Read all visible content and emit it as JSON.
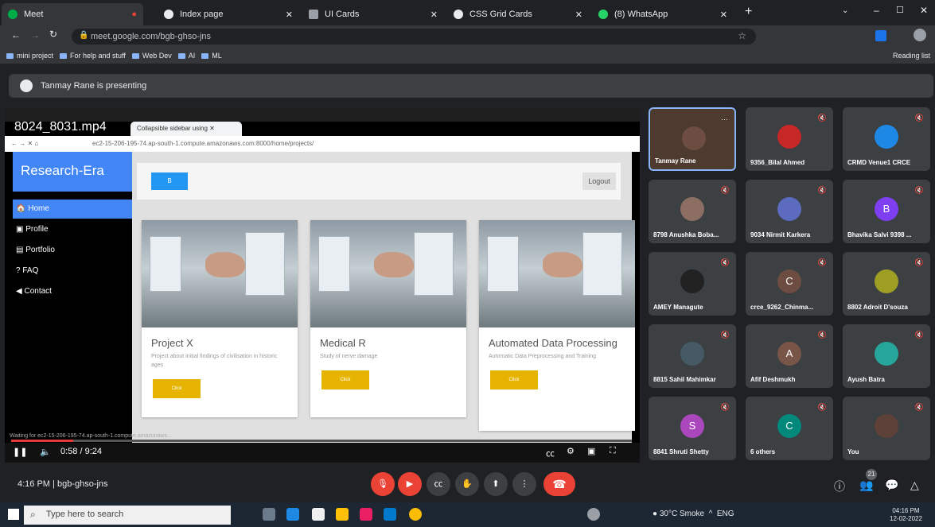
{
  "browser": {
    "tabs": [
      {
        "title": "Meet"
      },
      {
        "title": "Index page"
      },
      {
        "title": "UI Cards"
      },
      {
        "title": "CSS Grid Cards"
      },
      {
        "title": "(8) WhatsApp"
      }
    ],
    "url": "meet.google.com/bgb-ghso-jns",
    "bookmarks": [
      "mini project",
      "For help and stuff",
      "Web Dev",
      "AI",
      "ML"
    ],
    "reading_list": "Reading list"
  },
  "meet": {
    "presenting": "Tanmay Rane is presenting",
    "time": "4:16 PM",
    "meeting_code": "bgb-ghso-jns",
    "participant_count": "21"
  },
  "shared": {
    "video_title": "8024_8031.mp4",
    "inner_tab": "Collapsible sidebar using",
    "inner_url": "ec2-15-206-195-74.ap-south-1.compute.amazonaws.com:8000/home/projects/",
    "status_text": "Waiting for ec2-15-206-195-74.ap-south-1.compute.amazonaws...",
    "video_time": "0:58 / 9:24",
    "video_progress": 0.1,
    "site": {
      "brand": "Research-Era",
      "nav": [
        "Home",
        "Profile",
        "Portfolio",
        "FAQ",
        "Contact"
      ],
      "top_button": "B",
      "logout": "Logout",
      "cards": [
        {
          "title": "Project X",
          "desc": "Project about initial findings of civilisation in historic ages",
          "button": "Click"
        },
        {
          "title": "Medical R",
          "desc": "Study of nerve damage",
          "button": "Click"
        },
        {
          "title": "Automated Data Processing",
          "desc": "Automatic Data Preprocessing and Training",
          "button": "Click"
        }
      ]
    }
  },
  "participants": [
    {
      "name": "Tanmay Rane",
      "initial": "",
      "color": "#6d4c41"
    },
    {
      "name": "9356_Bilal Ahmed",
      "initial": "",
      "color": "#c62828"
    },
    {
      "name": "CRMD Venue1 CRCE",
      "initial": "",
      "color": "#1e88e5"
    },
    {
      "name": "8798 Anushka Boba...",
      "initial": "",
      "color": "#8d6e63"
    },
    {
      "name": "9034 Nirmit Karkera",
      "initial": "",
      "color": "#5c6bc0"
    },
    {
      "name": "Bhavika Salvi 9398 ...",
      "initial": "B",
      "color": "#7e3ff2"
    },
    {
      "name": "AMEY Managute",
      "initial": "",
      "color": "#212121"
    },
    {
      "name": "crce_9262_Chinma...",
      "initial": "C",
      "color": "#6d4c41"
    },
    {
      "name": "8802 Adroit D'souza",
      "initial": "",
      "color": "#9e9d24"
    },
    {
      "name": "8815 Sahil Mahimkar",
      "initial": "",
      "color": "#455a64"
    },
    {
      "name": "Afif Deshmukh",
      "initial": "A",
      "color": "#795548"
    },
    {
      "name": "Ayush Batra",
      "initial": "",
      "color": "#26a69a"
    },
    {
      "name": "8841 Shruti Shetty",
      "initial": "S",
      "color": "#ab47bc"
    },
    {
      "name": "6 others",
      "initial": "C",
      "color": "#00897b"
    },
    {
      "name": "You",
      "initial": "",
      "color": "#5d4037"
    }
  ],
  "taskbar": {
    "search_placeholder": "Type here to search",
    "weather": "30°C Smoke",
    "lang": "ENG",
    "time": "04:16 PM",
    "date": "12-02-2022"
  },
  "colors": {
    "accent_red": "#ea4335",
    "site_blue": "#4285f4",
    "card_button": "#e6b400"
  }
}
